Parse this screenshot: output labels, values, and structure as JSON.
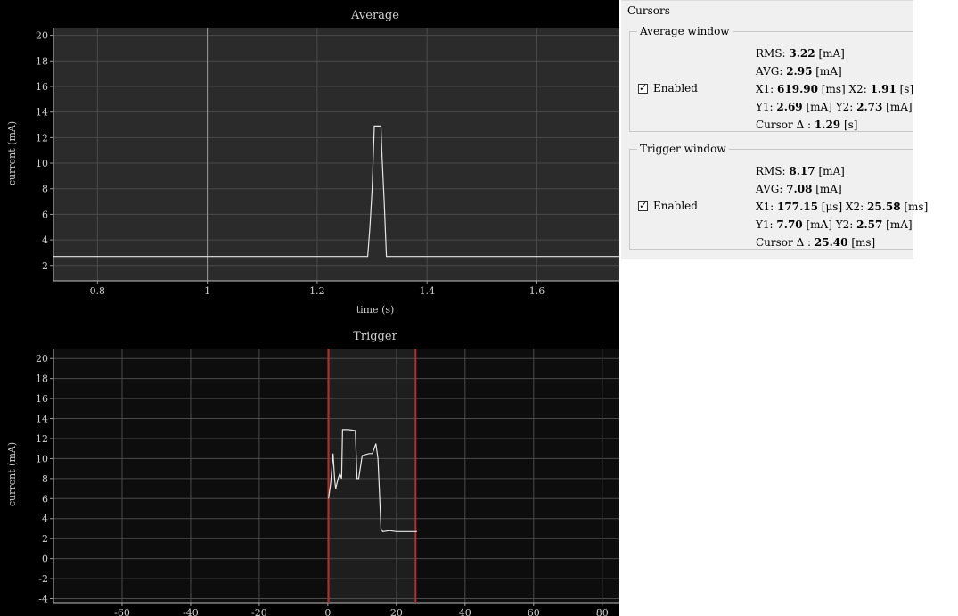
{
  "plots": {
    "average": {
      "title": "Average",
      "xlabel": "time (s)",
      "ylabel": "current (mA)",
      "xticks": [
        "0.8",
        "1",
        "1.2",
        "1.4",
        "1.6"
      ],
      "yticks": [
        "2",
        "4",
        "6",
        "8",
        "10",
        "12",
        "14",
        "16",
        "18",
        "20"
      ],
      "cursor_x": 1.0
    },
    "trigger": {
      "title": "Trigger",
      "ylabel": "current (mA)",
      "xticks": [
        "-60",
        "-40",
        "-20",
        "0",
        "20",
        "40",
        "60",
        "80"
      ],
      "yticks": [
        "-4",
        "-2",
        "0",
        "2",
        "4",
        "6",
        "8",
        "10",
        "12",
        "14",
        "16",
        "18",
        "20"
      ],
      "cursor_x1": 0.177,
      "cursor_x2": 25.58
    }
  },
  "chart_data": [
    {
      "type": "line",
      "title": "Average",
      "xlabel": "time (s)",
      "ylabel": "current (mA)",
      "xlim": [
        0.72,
        1.75
      ],
      "ylim": [
        0.8,
        20.6
      ],
      "series": [
        {
          "x": [
            0.72,
            1.2,
            1.28,
            1.292,
            1.296,
            1.3,
            1.302,
            1.304,
            1.31,
            1.316,
            1.318,
            1.322,
            1.326,
            1.33,
            1.4,
            1.6,
            1.75
          ],
          "y": [
            2.7,
            2.7,
            2.7,
            2.7,
            5.0,
            8.0,
            10.5,
            12.9,
            12.9,
            12.9,
            10.5,
            7.0,
            2.7,
            2.7,
            2.7,
            2.7,
            2.7
          ]
        }
      ],
      "grid": true,
      "colors": {
        "line": "#e6e6e6",
        "background": "#2b2b2b",
        "cursor": "#9a9a9a"
      }
    },
    {
      "type": "line",
      "title": "Trigger",
      "xlabel": "",
      "ylabel": "current (mA)",
      "xlim": [
        -80,
        85
      ],
      "ylim": [
        -4.4,
        21
      ],
      "series": [
        {
          "x": [
            0.2,
            0.8,
            1.5,
            2.0,
            2.3,
            3.0,
            3.5,
            4.0,
            4.3,
            6.0,
            8.0,
            8.5,
            9.0,
            10.0,
            12.0,
            13.0,
            14.0,
            14.6,
            15.0,
            15.5,
            16.0,
            18.0,
            20.0,
            22.0,
            24.0,
            26.0
          ],
          "y": [
            6.0,
            7.5,
            10.5,
            7.8,
            7.0,
            8.0,
            8.5,
            8.0,
            12.9,
            12.9,
            12.8,
            8.0,
            8.0,
            10.3,
            10.5,
            10.5,
            11.5,
            10.0,
            7.0,
            3.0,
            2.7,
            2.8,
            2.7,
            2.7,
            2.7,
            2.7
          ]
        }
      ],
      "grid": true,
      "colors": {
        "line": "#e6e6e6",
        "background": "#0d0d0d",
        "cursor": "#b03030",
        "window": "#1e1e1e"
      }
    }
  ],
  "cursors": {
    "title": "Cursors",
    "average": {
      "title": "Average window",
      "enabled_label": "Enabled",
      "rms_label": "RMS: ",
      "rms": "3.22",
      "rms_unit": " [mA]",
      "avg_label": "AVG: ",
      "avg": "2.95",
      "avg_unit": " [mA]",
      "x1_label": "X1: ",
      "x1": "619.90",
      "x1_unit": " [ms] X2: ",
      "x2": "1.91",
      "x2_unit": " [s]",
      "y1_label": "Y1: ",
      "y1": "2.69",
      "y1_unit": " [mA] Y2: ",
      "y2": "2.73",
      "y2_unit": " [mA]",
      "delta_label": "Cursor Δ : ",
      "delta": "1.29",
      "delta_unit": " [s]"
    },
    "trigger": {
      "title": "Trigger window",
      "enabled_label": "Enabled",
      "rms_label": "RMS: ",
      "rms": "8.17",
      "rms_unit": " [mA]",
      "avg_label": "AVG: ",
      "avg": "7.08",
      "avg_unit": " [mA]",
      "x1_label": "X1: ",
      "x1": "177.15",
      "x1_unit": " [μs] X2: ",
      "x2": "25.58",
      "x2_unit": " [ms]",
      "y1_label": "Y1: ",
      "y1": "7.70",
      "y1_unit": " [mA] Y2: ",
      "y2": "2.57",
      "y2_unit": " [mA]",
      "delta_label": "Cursor Δ : ",
      "delta": "25.40",
      "delta_unit": " [ms]"
    }
  }
}
